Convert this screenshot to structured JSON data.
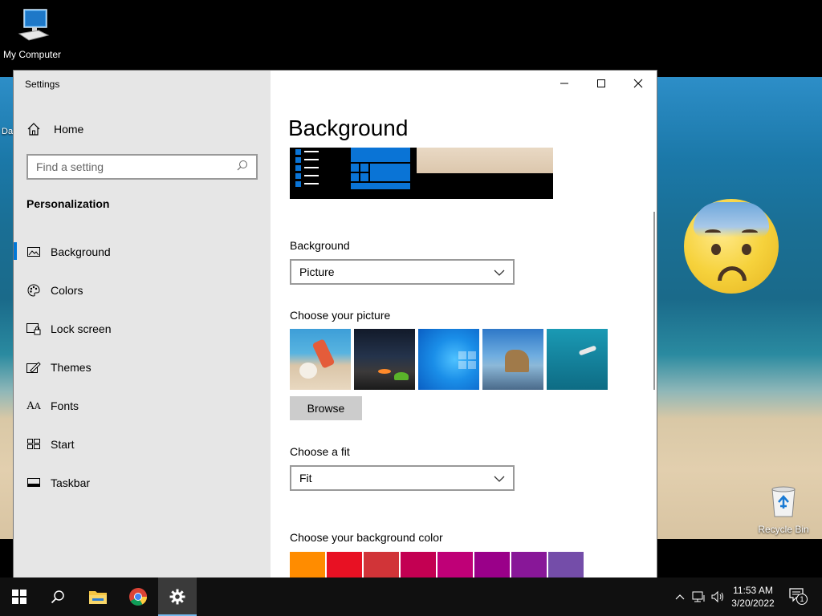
{
  "desktop": {
    "icons": {
      "my_computer": "My Computer",
      "recycle_bin": "Recycle Bin",
      "partial": "Da"
    }
  },
  "window": {
    "title": "Settings",
    "controls": [
      "minimize",
      "maximize",
      "close"
    ]
  },
  "sidebar": {
    "home": "Home",
    "search_placeholder": "Find a setting",
    "section": "Personalization",
    "items": [
      {
        "label": "Background",
        "icon": "picture-icon",
        "active": true
      },
      {
        "label": "Colors",
        "icon": "palette-icon",
        "active": false
      },
      {
        "label": "Lock screen",
        "icon": "lock-screen-icon",
        "active": false
      },
      {
        "label": "Themes",
        "icon": "themes-icon",
        "active": false
      },
      {
        "label": "Fonts",
        "icon": "fonts-icon",
        "active": false
      },
      {
        "label": "Start",
        "icon": "start-icon",
        "active": false
      },
      {
        "label": "Taskbar",
        "icon": "taskbar-icon",
        "active": false
      }
    ]
  },
  "content": {
    "title": "Background",
    "background_label": "Background",
    "background_value": "Picture",
    "choose_picture_label": "Choose your picture",
    "browse_label": "Browse",
    "fit_label": "Choose a fit",
    "fit_value": "Fit",
    "color_label": "Choose your background color",
    "colors": [
      "#ff8c00",
      "#e81123",
      "#d13438",
      "#c30052",
      "#bf0077",
      "#9a0089",
      "#881798",
      "#744da9"
    ]
  },
  "taskbar": {
    "time": "11:53 AM",
    "date": "3/20/2022",
    "notification_count": "1"
  },
  "colors": {
    "accent": "#0078d7",
    "sidebar_bg": "#e6e6e6",
    "taskbar_bg": "#101010"
  }
}
